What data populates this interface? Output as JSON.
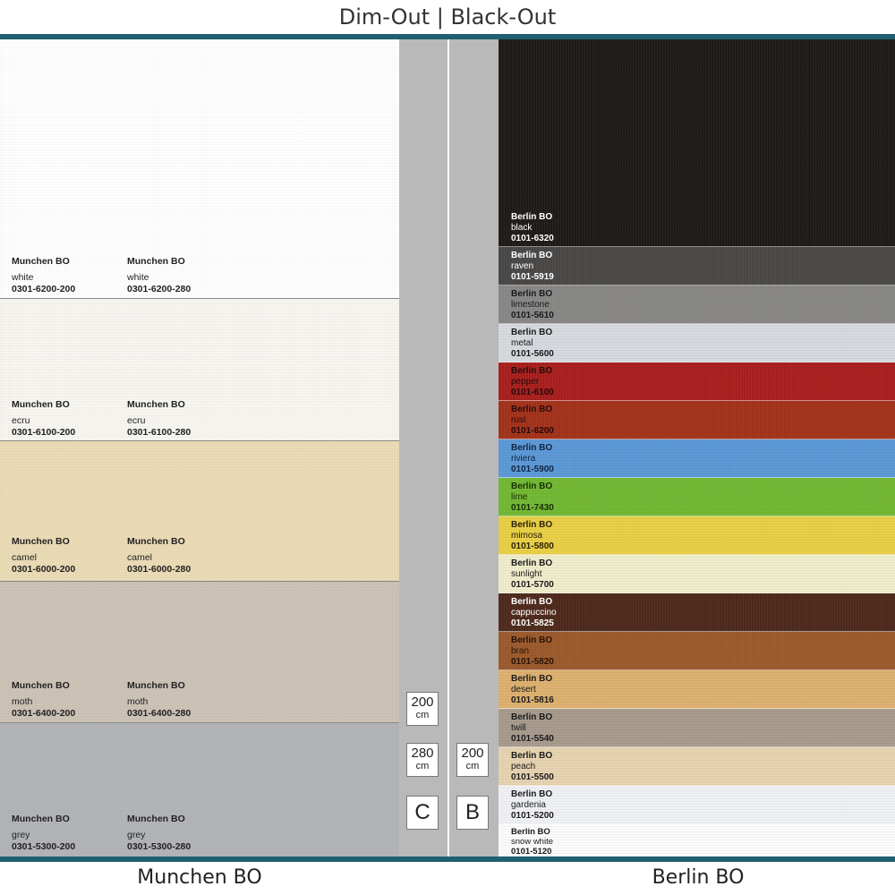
{
  "page": {
    "title": "Dim-Out | Black-Out",
    "left_footer": "Munchen BO",
    "right_footer": "Berlin BO",
    "accent_color": "#1f5f72"
  },
  "munchen": {
    "swatches": [
      {
        "color": "#ffffff",
        "left": {
          "name": "Munchen BO",
          "color_name": "white",
          "code": "0301-6200-200"
        },
        "right": {
          "name": "Munchen BO",
          "color_name": "white",
          "code": "0301-6200-280"
        }
      },
      {
        "color": "#f8f6f1",
        "left": {
          "name": "Munchen BO",
          "color_name": "ecru",
          "code": "0301-6100-200"
        },
        "right": {
          "name": "Munchen BO",
          "color_name": "ecru",
          "code": "0301-6100-280"
        }
      },
      {
        "color": "#ecdcb7",
        "left": {
          "name": "Munchen BO",
          "color_name": "camel",
          "code": "0301-6000-200"
        },
        "right": {
          "name": "Munchen BO",
          "color_name": "camel",
          "code": "0301-6000-280"
        }
      },
      {
        "color": "#cdc4b7",
        "left": {
          "name": "Munchen BO",
          "color_name": "moth",
          "code": "0301-6400-200"
        },
        "right": {
          "name": "Munchen BO",
          "color_name": "moth",
          "code": "0301-6400-280"
        }
      },
      {
        "color": "#b3b5b8",
        "left": {
          "name": "Munchen BO",
          "color_name": "grey",
          "code": "0301-5300-200"
        },
        "right": {
          "name": "Munchen BO",
          "color_name": "grey",
          "code": "0301-5300-280"
        }
      }
    ]
  },
  "width_boxes": {
    "c_200": {
      "num": "200",
      "unit": "cm"
    },
    "c_280": {
      "num": "280",
      "unit": "cm"
    },
    "b_200": {
      "num": "200",
      "unit": "cm"
    },
    "c_letter": "C",
    "b_letter": "B"
  },
  "berlin": {
    "swatches": [
      {
        "color": "#1e1b19",
        "text_color": "#ffffff",
        "name": "Berlin BO",
        "color_name": "black",
        "code": "0101-6320"
      },
      {
        "color": "#4a4847",
        "text_color": "#ffffff",
        "name": "Berlin BO",
        "color_name": "raven",
        "code": "0101-5919"
      },
      {
        "color": "#888786",
        "text_color": "#1a1a1a",
        "name": "Berlin BO",
        "color_name": "limestone",
        "code": "0101-5610"
      },
      {
        "color": "#d6d9df",
        "text_color": "#1a1a1a",
        "name": "Berlin BO",
        "color_name": "metal",
        "code": "0101-5600"
      },
      {
        "color": "#a81f1d",
        "text_color": "#2a0a0a",
        "name": "Berlin BO",
        "color_name": "pepper",
        "code": "0101-6100"
      },
      {
        "color": "#a2321a",
        "text_color": "#2a0a0a",
        "name": "Berlin BO",
        "color_name": "rust",
        "code": "0101-6200"
      },
      {
        "color": "#5c98d6",
        "text_color": "#0f2540",
        "name": "Berlin BO",
        "color_name": "riviera",
        "code": "0101-5900"
      },
      {
        "color": "#72b833",
        "text_color": "#173005",
        "name": "Berlin BO",
        "color_name": "lime",
        "code": "0101-7430"
      },
      {
        "color": "#e8cf45",
        "text_color": "#2a2205",
        "name": "Berlin BO",
        "color_name": "mimosa",
        "code": "0101-5800"
      },
      {
        "color": "#efeccb",
        "text_color": "#1a1a1a",
        "name": "Berlin BO",
        "color_name": "sunlight",
        "code": "0101-5700"
      },
      {
        "color": "#4e2a1c",
        "text_color": "#ffffff",
        "name": "Berlin BO",
        "color_name": "cappuccino",
        "code": "0101-5825"
      },
      {
        "color": "#9b5a2c",
        "text_color": "#2a1206",
        "name": "Berlin BO",
        "color_name": "bran",
        "code": "0101-5820"
      },
      {
        "color": "#ddb06e",
        "text_color": "#1a1a1a",
        "name": "Berlin BO",
        "color_name": "desert",
        "code": "0101-5816"
      },
      {
        "color": "#a79a8c",
        "text_color": "#1a1a1a",
        "name": "Berlin BO",
        "color_name": "twill",
        "code": "0101-5540"
      },
      {
        "color": "#e6d2b0",
        "text_color": "#1a1a1a",
        "name": "Berlin BO",
        "color_name": "peach",
        "code": "0101-5500"
      },
      {
        "color": "#eef0f4",
        "text_color": "#1a1a1a",
        "name": "Berlin BO",
        "color_name": "gardenia",
        "code": "0101-5200"
      },
      {
        "color": "#fbfbfb",
        "text_color": "#1a1a1a",
        "name": "Berlin BO",
        "color_name": "snow white",
        "code": "0101-5120"
      }
    ]
  }
}
